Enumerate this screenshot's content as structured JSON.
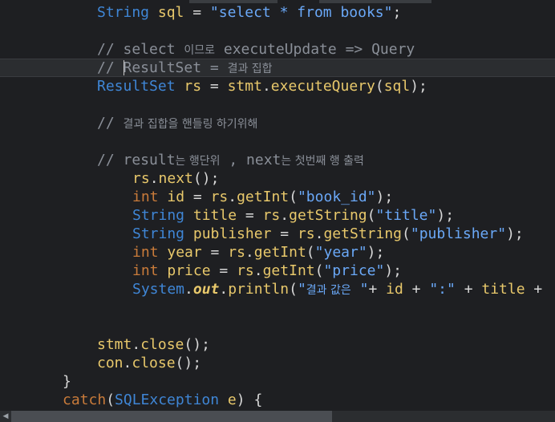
{
  "code": {
    "l1": {
      "type": "String",
      "var": "sql",
      "eq": " = ",
      "str": "\"select * from books\"",
      "end": ";"
    },
    "l2": {
      "comment": "// select ",
      "ko": "이므로",
      "rest": " executeUpdate => Query"
    },
    "l3": {
      "comment": "// ResultSet = ",
      "ko": "결과 집합"
    },
    "l4": {
      "type": "ResultSet",
      "var": "rs",
      "eq": " = ",
      "obj": "stmt",
      "dot": ".",
      "method": "executeQuery",
      "open": "(",
      "arg": "sql",
      "close": ");"
    },
    "l5": {
      "comment": "// ",
      "ko": "결과 집합을 핸들링 하기위해"
    },
    "l6": {
      "c1": "// result",
      "k1": "는 행단위",
      "c2": " , next",
      "k2": "는 첫번째 행 출력"
    },
    "l7": {
      "obj": "rs",
      "dot": ".",
      "method": "next",
      "rest": "();"
    },
    "l8": {
      "type": "int",
      "var": "id",
      "eq": " = ",
      "obj": "rs",
      "dot": ".",
      "method": "getInt",
      "open": "(",
      "str": "\"book_id\"",
      "close": ");"
    },
    "l9": {
      "type": "String",
      "var": "title",
      "eq": " = ",
      "obj": "rs",
      "dot": ".",
      "method": "getString",
      "open": "(",
      "str": "\"title\"",
      "close": ");"
    },
    "l10": {
      "type": "String",
      "var": "publisher",
      "eq": " = ",
      "obj": "rs",
      "dot": ".",
      "method": "getString",
      "open": "(",
      "str": "\"publisher\"",
      "close": ");"
    },
    "l11": {
      "type": "int",
      "var": "year",
      "eq": " = ",
      "obj": "rs",
      "dot": ".",
      "method": "getInt",
      "open": "(",
      "str": "\"year\"",
      "close": ");"
    },
    "l12": {
      "type": "int",
      "var": "price",
      "eq": " = ",
      "obj": "rs",
      "dot": ".",
      "method": "getInt",
      "open": "(",
      "str": "\"price\"",
      "close": ");"
    },
    "l13": {
      "cls": "System",
      "dot": ".",
      "out": "out",
      "dot2": ".",
      "method": "println",
      "open": "(",
      "q": "\"",
      "ko": "결과 값은",
      "s2": " \"",
      "rest1": "+ ",
      "v1": "id",
      "rest2": " + ",
      "s3": "\":\"",
      "rest3": " + ",
      "v2": "title",
      "rest4": " +"
    },
    "l14": {
      "obj": "stmt",
      "dot": ".",
      "method": "close",
      "rest": "();"
    },
    "l15": {
      "obj": "con",
      "dot": ".",
      "method": "close",
      "rest": "();"
    },
    "l16": {
      "brace": "}"
    },
    "l17": {
      "kw": "catch",
      "open": "(",
      "type": "SQLException",
      "var": "e",
      "rest": ") {"
    }
  },
  "colors": {
    "background": "#1e1f22",
    "keyword": "#c97b3a",
    "type": "#3f86d6",
    "string": "#6aa8f7",
    "identifier": "#e8c86b",
    "comment": "#8a8f98"
  }
}
